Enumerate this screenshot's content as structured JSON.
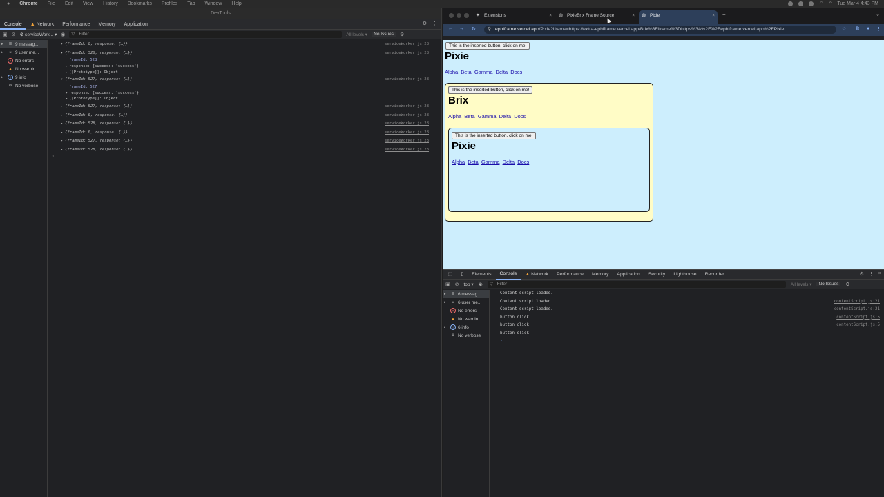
{
  "menubar": {
    "app": "Chrome",
    "items": [
      "File",
      "Edit",
      "View",
      "History",
      "Bookmarks",
      "Profiles",
      "Tab",
      "Window",
      "Help"
    ],
    "clock": "Tue Mar 4  4:43 PM"
  },
  "left_devtools": {
    "title": "DevTools",
    "tabs": [
      "Console",
      "Network",
      "Performance",
      "Memory",
      "Application"
    ],
    "context": "serviceWork...",
    "filter_placeholder": "Filter",
    "levels": "All levels",
    "issues": "No Issues",
    "sidebar": [
      {
        "label": "9 messag...",
        "icon": "list-icon"
      },
      {
        "label": "9 user me...",
        "icon": "user-icon"
      },
      {
        "label": "No errors",
        "icon": "error-icon"
      },
      {
        "label": "No warnin...",
        "icon": "warning-icon"
      },
      {
        "label": "9 info",
        "icon": "info-icon"
      },
      {
        "label": "No verbose",
        "icon": "verbose-icon"
      }
    ],
    "logs": [
      {
        "text": "{frameId: 0, response: {…}}",
        "src": "serviceWorker.js:28"
      },
      {
        "text": "{frameId: 528, response: {…}}",
        "src": "serviceWorker.js:28"
      },
      {
        "text": "{frameId: 527, response: {…}}",
        "src": "serviceWorker.js:28"
      },
      {
        "text": "{frameId: 527, response: {…}}",
        "src": "serviceWorker.js:28"
      },
      {
        "text": "{frameId: 0, response: {…}}",
        "src": "serviceWorker.js:28"
      },
      {
        "text": "{frameId: 528, response: {…}}",
        "src": "serviceWorker.js:28"
      },
      {
        "text": "{frameId: 0, response: {…}}",
        "src": "serviceWorker.js:28"
      },
      {
        "text": "{frameId: 527, response: {…}}",
        "src": "serviceWorker.js:28"
      },
      {
        "text": "{frameId: 528, response: {…}}",
        "src": "serviceWorker.js:28"
      }
    ],
    "expanded_a": {
      "frameId": "frameId: 528",
      "response": "response: {success: 'success'}",
      "proto": "[[Prototype]]: Object"
    },
    "expanded_b": {
      "frameId": "frameId: 527",
      "response": "response: {success: 'success'}",
      "proto": "[[Prototype]]: Object"
    }
  },
  "browser": {
    "tabs": [
      {
        "label": "Extensions",
        "icon": "puzzle-icon"
      },
      {
        "label": "PixieBrix Frame Source",
        "icon": "globe-icon"
      },
      {
        "label": "Pixie",
        "icon": "globe-icon"
      }
    ],
    "url_host": "ephiframe.vercel.app",
    "url_rest": "/Pixie?iframe=https://extra-ephiframe.vercel.app/Brix%3Fiframe%3Dhttps%3A%2F%2Fephiframe.vercel.app%2FPixie",
    "page": {
      "button_label": "This is the inserted button, click on me!",
      "outer_title": "Pixie",
      "mid_title": "Brix",
      "inner_title": "Pixie",
      "links": [
        "Alpha",
        "Beta",
        "Gamma",
        "Delta",
        "Docs"
      ]
    },
    "devtools": {
      "tabs": [
        "Elements",
        "Console",
        "Network",
        "Performance",
        "Memory",
        "Application",
        "Security",
        "Lighthouse",
        "Recorder"
      ],
      "context": "top",
      "filter_placeholder": "Filter",
      "levels": "All levels",
      "issues": "No Issues",
      "sidebar": [
        {
          "label": "6 messag...",
          "icon": "list-icon"
        },
        {
          "label": "6 user me...",
          "icon": "user-icon"
        },
        {
          "label": "No errors",
          "icon": "error-icon"
        },
        {
          "label": "No warnin...",
          "icon": "warning-icon"
        },
        {
          "label": "6 info",
          "icon": "info-icon"
        },
        {
          "label": "No verbose",
          "icon": "verbose-icon"
        }
      ],
      "logs": [
        {
          "text": "Content script loaded.",
          "src": ""
        },
        {
          "text": "Content script loaded.",
          "src": "contentScript.js:21"
        },
        {
          "text": "Content script loaded.",
          "src": "contentScript.js:21"
        },
        {
          "text": "button click",
          "src": "contentScript.js:5"
        },
        {
          "text": "button click",
          "src": "contentScript.js:5"
        },
        {
          "text": "button click",
          "src": ""
        }
      ]
    }
  }
}
